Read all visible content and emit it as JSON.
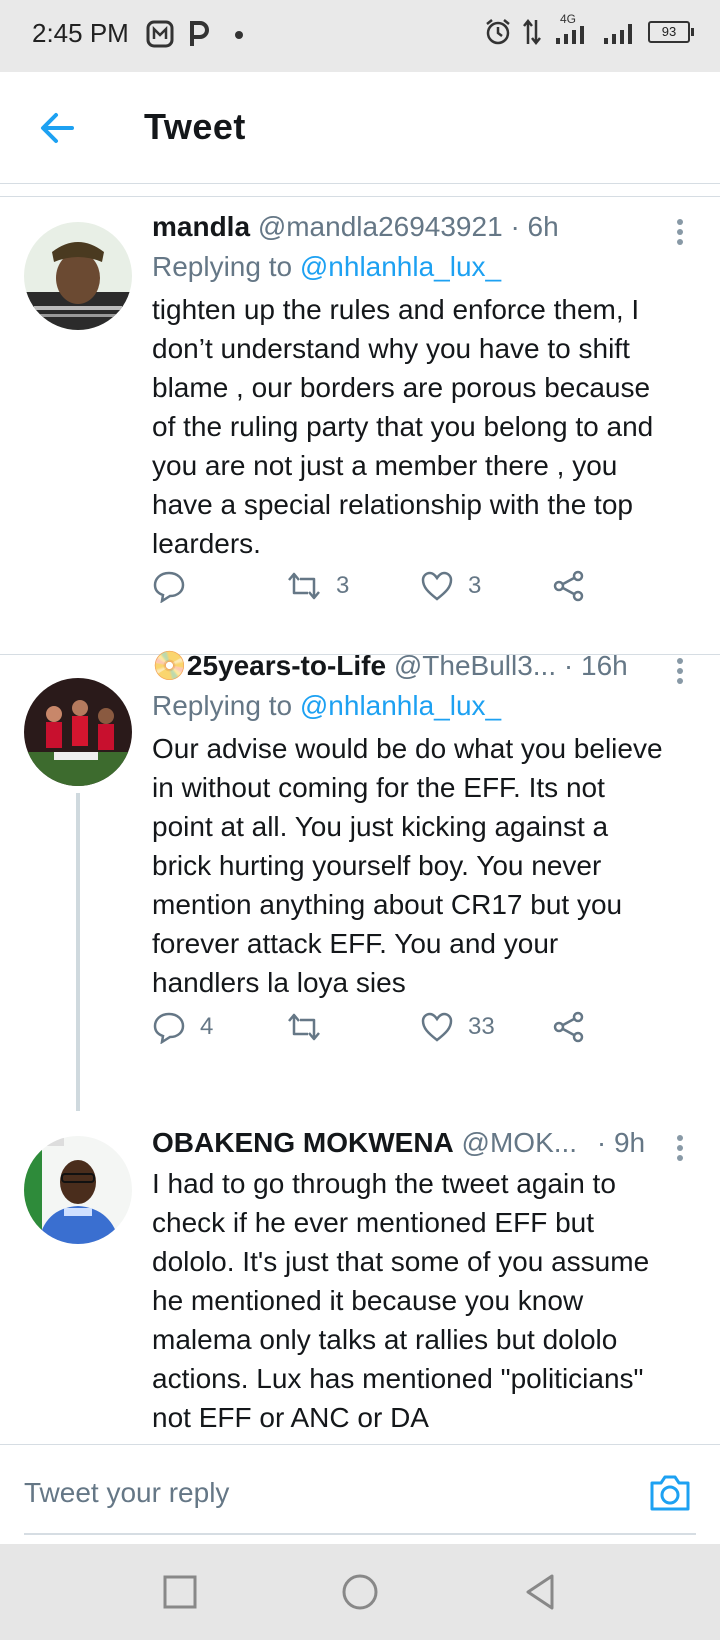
{
  "status_bar": {
    "time": "2:45 PM",
    "network": "4G",
    "battery": "93"
  },
  "header": {
    "title": "Tweet",
    "back_icon": "arrow-left-icon"
  },
  "tweets": [
    {
      "name": "mandla",
      "handle": "@mandla26943921",
      "time": "· 6h",
      "replying_prefix": "Replying to ",
      "replying_to": "@nhlanhla_lux_",
      "body": [
        "tighten up the rules and enforce them, I",
        "don’t understand why you have to shift",
        "blame , our borders are porous because",
        "of the ruling party that you belong to and",
        "you are not just a member there , you",
        "have a special relationship with the top",
        "learders."
      ],
      "replies": "",
      "retweets": "3",
      "likes": "3"
    },
    {
      "emoji": "📀",
      "name": "25years-to-Life",
      "handle": "@TheBull3...",
      "time": "· 16h",
      "replying_prefix": "Replying to ",
      "replying_to": "@nhlanhla_lux_",
      "body": [
        "Our advise would be do what you believe",
        "in without coming for the EFF. Its not",
        "point at all. You just kicking against a",
        "brick hurting yourself boy. You never",
        "mention anything about CR17 but you",
        "forever attack EFF. You and your",
        "handlers la loya sies"
      ],
      "replies": "4",
      "retweets": "",
      "likes": "33"
    },
    {
      "name": "OBAKENG MOKWENA",
      "handle": "@MOK...",
      "time": "· 9h",
      "body": [
        "I had to go through the tweet again to",
        "check if he ever mentioned EFF but",
        "dololo. It's just that some of you assume",
        "he mentioned it because you know",
        "malema only talks at rallies but dololo",
        "actions. Lux has mentioned \"politicians\"",
        "not EFF or ANC or DA"
      ]
    }
  ],
  "reply_bar": {
    "placeholder": "Tweet your reply"
  },
  "colors": {
    "accent": "#1da1f2",
    "secondary_text": "#657786",
    "primary_text": "#14171a"
  }
}
